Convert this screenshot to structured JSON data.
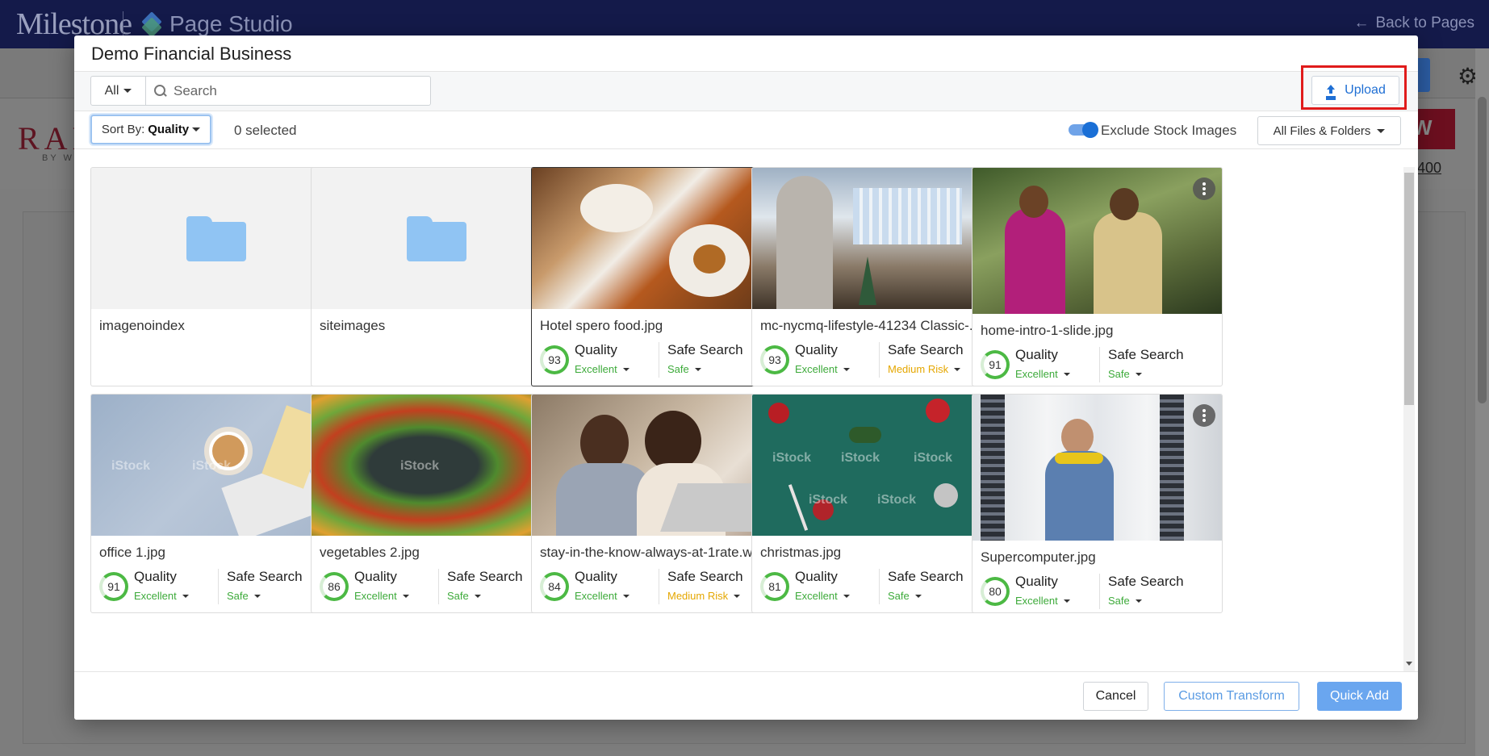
{
  "background": {
    "brand": "Milestone",
    "app_name": "Page Studio",
    "back_link": "Back to Pages",
    "site_logo": "RAM",
    "site_logo_sub": "BY W",
    "phone_partial": "400"
  },
  "modal": {
    "title": "Demo Financial Business",
    "filter_select": "All",
    "search_placeholder": "Search",
    "upload_label": "Upload",
    "sort_prefix": "Sort By:",
    "sort_value": "Quality",
    "selected_count": "0 selected",
    "exclude_stock_label": "Exclude Stock Images",
    "exclude_stock_on": true,
    "files_select": "All Files & Folders",
    "metric_labels": {
      "quality": "Quality",
      "safe_search": "Safe Search"
    },
    "items": [
      {
        "kind": "folder",
        "name": "imagenoindex"
      },
      {
        "kind": "folder",
        "name": "siteimages"
      },
      {
        "kind": "image",
        "name": "Hotel spero food.jpg",
        "score": "93",
        "quality": "Excellent",
        "safe": "Safe",
        "selected": true
      },
      {
        "kind": "image",
        "name": "mc-nycmq-lifestyle-41234 Classic-...",
        "score": "93",
        "quality": "Excellent",
        "safe": "Medium Risk"
      },
      {
        "kind": "image",
        "name": "home-intro-1-slide.jpg",
        "score": "91",
        "quality": "Excellent",
        "safe": "Safe"
      },
      {
        "kind": "image",
        "name": "office 1.jpg",
        "score": "91",
        "quality": "Excellent",
        "safe": "Safe",
        "watermark": "iStock"
      },
      {
        "kind": "image",
        "name": "vegetables 2.jpg",
        "score": "86",
        "quality": "Excellent",
        "safe": "Safe",
        "watermark": "iStock"
      },
      {
        "kind": "image",
        "name": "stay-in-the-know-always-at-1rate.w...",
        "score": "84",
        "quality": "Excellent",
        "safe": "Medium Risk"
      },
      {
        "kind": "image",
        "name": "christmas.jpg",
        "score": "81",
        "quality": "Excellent",
        "safe": "Safe",
        "watermark": "iStock"
      },
      {
        "kind": "image",
        "name": "Supercomputer.jpg",
        "score": "80",
        "quality": "Excellent",
        "safe": "Safe"
      }
    ],
    "footer": {
      "cancel": "Cancel",
      "custom_transform": "Custom Transform",
      "quick_add": "Quick Add"
    }
  },
  "colors": {
    "accent": "#1f6fd4",
    "excellent": "#3daa3a",
    "safe": "#3daa3a",
    "medium_risk": "#e5a700",
    "highlight": "#e01b1b"
  }
}
